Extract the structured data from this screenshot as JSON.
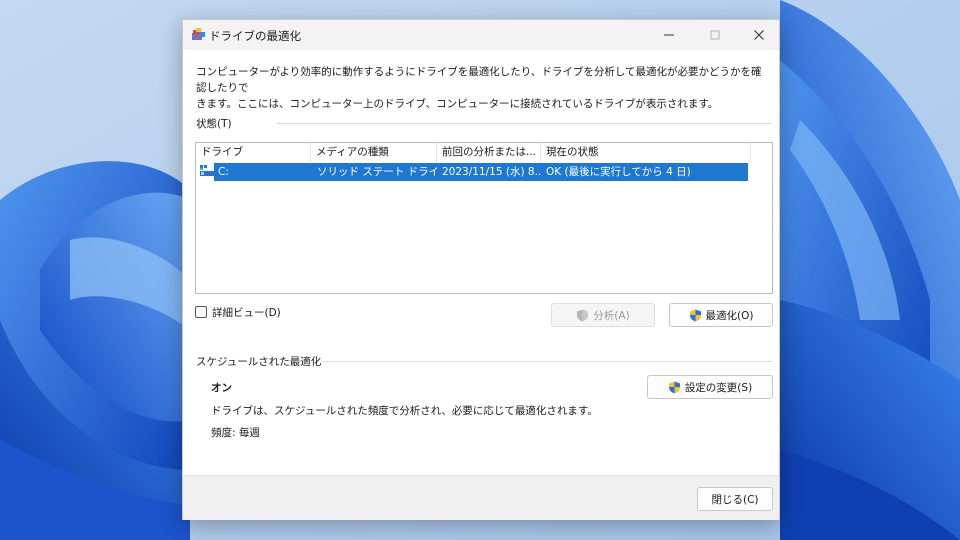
{
  "window": {
    "title": "ドライブの最適化"
  },
  "description": {
    "line1": "コンピューターがより効率的に動作するようにドライブを最適化したり、ドライブを分析して最適化が必要かどうかを確認したりで",
    "line2": "きます。ここには、コンピューター上のドライブ、コンピューターに接続されているドライブが表示されます。"
  },
  "status_section": {
    "label": "状態(T)"
  },
  "drive_list": {
    "columns": [
      "ドライブ",
      "メディアの種類",
      "前回の分析または...",
      "現在の状態"
    ],
    "rows": [
      {
        "drive": "C:",
        "media_type": "ソリッド ステート ドライブ",
        "last_run": "2023/11/15 (水) 8...",
        "status": "OK (最後に実行してから 4 日)",
        "selected": true
      }
    ]
  },
  "controls": {
    "detail_view_label": "詳細ビュー(D)",
    "detail_view_checked": false,
    "analyze_label": "分析(A)",
    "optimize_label": "最適化(O)"
  },
  "schedule": {
    "section_label": "スケジュールされた最適化",
    "state": "オン",
    "description": "ドライブは、スケジュールされた頻度で分析され、必要に応じて最適化されます。",
    "frequency": "頻度: 毎週",
    "change_settings_label": "設定の変更(S)"
  },
  "footer": {
    "close_label": "閉じる(C)"
  },
  "colors": {
    "selection": "#1e78d2",
    "wallpaper_blue": "#1a5fd8",
    "wallpaper_light": "#b7d0ee"
  }
}
